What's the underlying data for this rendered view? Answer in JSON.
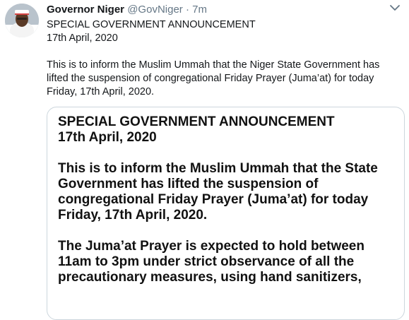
{
  "tweet": {
    "display_name": "Governor Niger",
    "handle": "@GovNiger",
    "separator": "·",
    "timestamp": "7m",
    "text_lines": [
      "SPECIAL GOVERNMENT ANNOUNCEMENT",
      "17th April, 2020",
      "",
      "This is to inform the Muslim Ummah that the Niger State Government has",
      "lifted the suspension of congregational Friday Prayer (Juma’at) for today",
      "Friday, 17th April, 2020."
    ],
    "avatar_icon": "user-avatar-photo",
    "menu_icon": "chevron-down-icon"
  },
  "media": {
    "lines": [
      "SPECIAL GOVERNMENT ANNOUNCEMENT",
      "17th April, 2020",
      "",
      "This is to inform the Muslim Ummah that the State",
      "Government has lifted the suspension of",
      "congregational Friday Prayer (Juma’at) for today",
      "Friday, 17th April, 2020.",
      "",
      "The Juma’at Prayer is expected to hold between",
      "11am to 3pm under strict observance of all the",
      "precautionary measures, using hand sanitizers,"
    ]
  },
  "colors": {
    "text": "#14171a",
    "secondary": "#657786",
    "border": "#ccd6dd"
  }
}
